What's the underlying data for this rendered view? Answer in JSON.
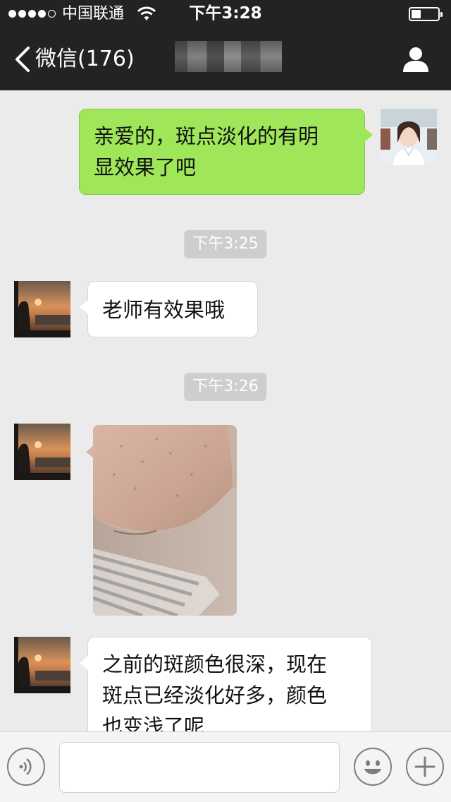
{
  "status_bar": {
    "carrier": "中国联通",
    "time": "下午3:28",
    "signal_bars_filled": 4,
    "signal_bars_total": 5,
    "battery_level": 0.35
  },
  "nav": {
    "back_label": "微信(176)",
    "title": "",
    "icons": {
      "back": "chevron-left-icon",
      "profile": "person-icon"
    }
  },
  "messages": [
    {
      "type": "text",
      "side": "out",
      "lines": [
        "亲爱的，斑点淡化的有明",
        "显效果了吧"
      ]
    },
    {
      "type": "time",
      "text": "下午3:25"
    },
    {
      "type": "text",
      "side": "in",
      "lines": [
        "老师有效果哦"
      ]
    },
    {
      "type": "time",
      "text": "下午3:26"
    },
    {
      "type": "image",
      "side": "in",
      "description_icon": "photo-icon"
    },
    {
      "type": "text",
      "side": "in",
      "lines": [
        "之前的斑颜色很深，现在",
        "斑点已经淡化好多，颜色",
        "也变浅了呢"
      ]
    }
  ],
  "input_bar": {
    "placeholder": "",
    "icons": {
      "voice": "voice-icon",
      "emoji": "emoji-icon",
      "more": "plus-icon"
    }
  },
  "colors": {
    "nav_bg": "#232323",
    "chat_bg": "#ebebeb",
    "outgoing_bubble": "#9fe658",
    "incoming_bubble": "#ffffff",
    "timestamp_bg": "#cecece"
  }
}
